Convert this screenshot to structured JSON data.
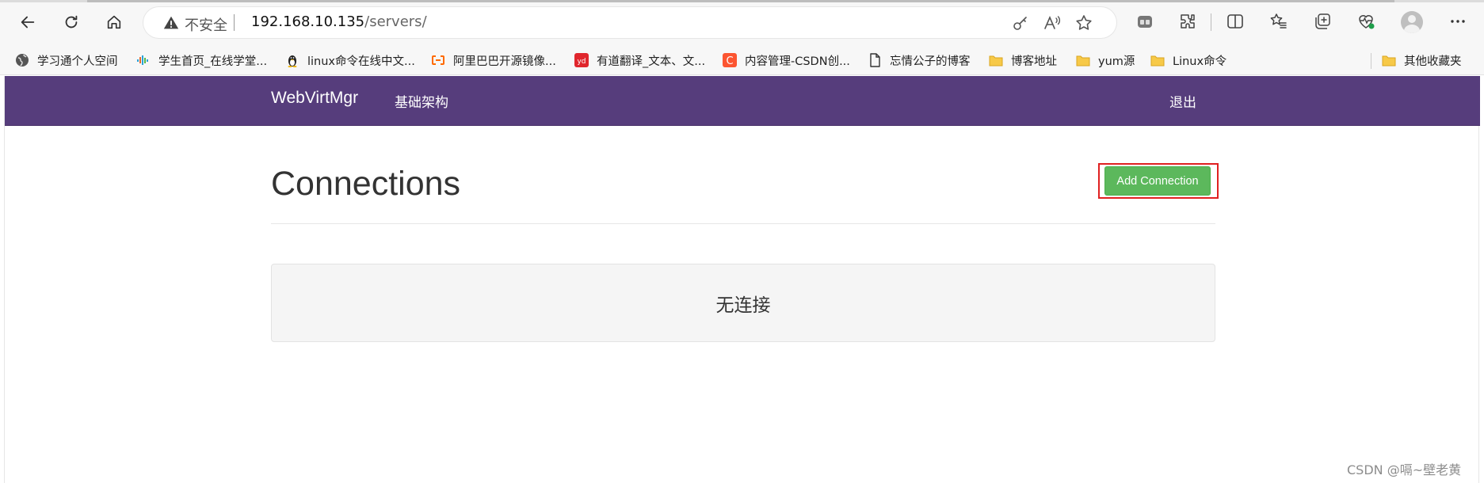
{
  "browser": {
    "security_label": "不安全",
    "url_host": "192.168.10.135",
    "url_path": "/servers/"
  },
  "bookmarks": [
    {
      "label": "学习通个人空间",
      "icon": "globe-icon"
    },
    {
      "label": "学生首页_在线学堂...",
      "icon": "waveform-icon"
    },
    {
      "label": "linux命令在线中文...",
      "icon": "penguin-icon"
    },
    {
      "label": "阿里巴巴开源镜像...",
      "icon": "aliyun-icon"
    },
    {
      "label": "有道翻译_文本、文...",
      "icon": "youdao-icon"
    },
    {
      "label": "内容管理-CSDN创...",
      "icon": "csdn-icon"
    },
    {
      "label": "忘情公子的博客",
      "icon": "page-icon"
    },
    {
      "label": "博客地址",
      "icon": "folder-icon"
    },
    {
      "label": "yum源",
      "icon": "folder-icon"
    },
    {
      "label": "Linux命令",
      "icon": "folder-icon"
    },
    {
      "label": "其他收藏夹",
      "icon": "folder-icon"
    }
  ],
  "navbar": {
    "brand": "WebVirtMgr",
    "link": "基础架构",
    "logout": "退出"
  },
  "main": {
    "title": "Connections",
    "add_button": "Add Connection",
    "empty_text": "无连接"
  },
  "watermark": "CSDN @嗝~壁老黄",
  "colors": {
    "navbar": "#563d7c",
    "button": "#5cb85c",
    "highlight": "#e02020"
  }
}
